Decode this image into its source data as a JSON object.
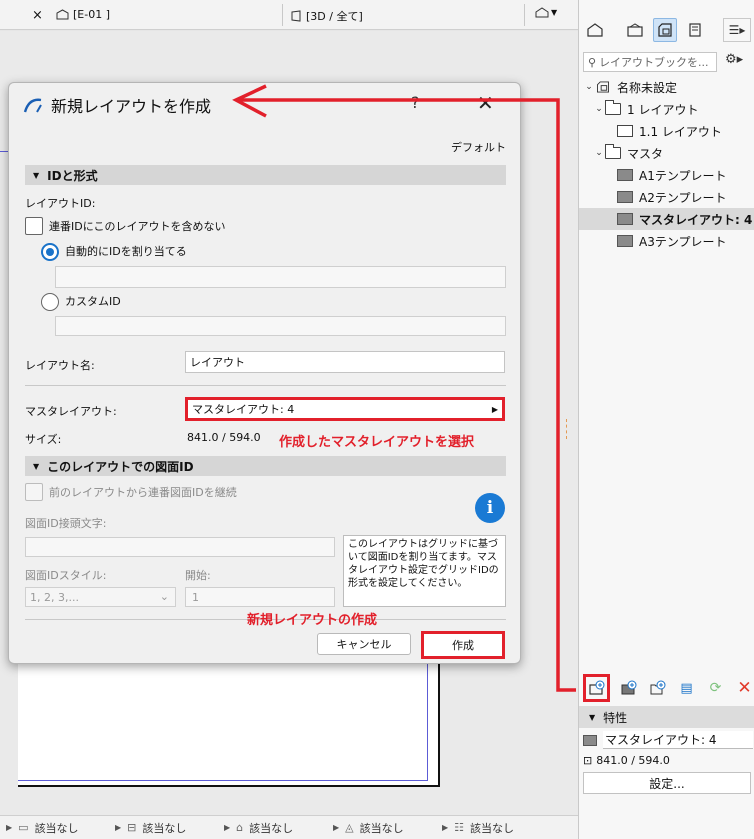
{
  "tabbar": {
    "close_label": "×",
    "tab1_label": "[E-01 ]",
    "tab2_label": "[3D / 全て]"
  },
  "statusbar": {
    "items": [
      {
        "icon": "layer-icon",
        "label": "該当なし"
      },
      {
        "icon": "scale-icon",
        "label": "該当なし"
      },
      {
        "icon": "pen-icon",
        "label": "該当なし"
      },
      {
        "icon": "model-icon",
        "label": "該当なし"
      },
      {
        "icon": "renovation-icon",
        "label": "該当なし"
      }
    ]
  },
  "navigator": {
    "search_placeholder": "レイアウトブックを...",
    "tree": [
      {
        "label": "名称未設定",
        "level": 0,
        "icon": "book-icon",
        "expanded": true
      },
      {
        "label": "1 レイアウト",
        "level": 1,
        "icon": "folder-icon",
        "expanded": true
      },
      {
        "label": "1.1 レイアウト",
        "level": 2,
        "icon": "layout-icon"
      },
      {
        "label": "マスタ",
        "level": 1,
        "icon": "folder-icon",
        "expanded": true
      },
      {
        "label": "A1テンプレート",
        "level": 2,
        "icon": "master-icon"
      },
      {
        "label": "A2テンプレート",
        "level": 2,
        "icon": "master-icon"
      },
      {
        "label": "マスタレイアウト: 4",
        "level": 2,
        "icon": "master-icon",
        "selected": true
      },
      {
        "label": "A3テンプレート",
        "level": 2,
        "icon": "master-icon"
      }
    ],
    "properties_label": "特性",
    "prop_master_value": "マスタレイアウト: 4",
    "prop_size_value": "841.0 / 594.0",
    "settings_label": "設定..."
  },
  "dialog": {
    "title": "新規レイアウトを作成",
    "help": "?",
    "default_label": "デフォルト",
    "section_id": "IDと形式",
    "layout_id_label": "レイアウトID:",
    "exclude_label": "連番IDにこのレイアウトを含めない",
    "auto_id_label": "自動的にIDを割り当てる",
    "custom_id_label": "カスタムID",
    "layout_name_label": "レイアウト名:",
    "layout_name_value": "レイアウト",
    "master_label": "マスタレイアウト:",
    "master_value": "マスタレイアウト: 4",
    "size_label": "サイズ:",
    "size_value": "841.0 / 594.0",
    "section_drawing": "このレイアウトでの図面ID",
    "continue_label": "前のレイアウトから連番図面IDを継続",
    "prefix_label": "図面ID接頭文字:",
    "style_label": "図面IDスタイル:",
    "start_label": "開始:",
    "style_value": "1, 2, 3,...",
    "start_value": "1",
    "note_text": "このレイアウトはグリッドに基づいて図面IDを割り当てます。マスタレイアウト設定でグリッドIDの形式を設定してください。",
    "cancel_label": "キャンセル",
    "create_label": "作成"
  },
  "annotations": {
    "select_master": "作成したマスタレイアウトを選択",
    "create_new": "新規レイアウトの作成"
  },
  "colors": {
    "annotation_red": "#e2202b",
    "accent_blue": "#1a73c9"
  }
}
